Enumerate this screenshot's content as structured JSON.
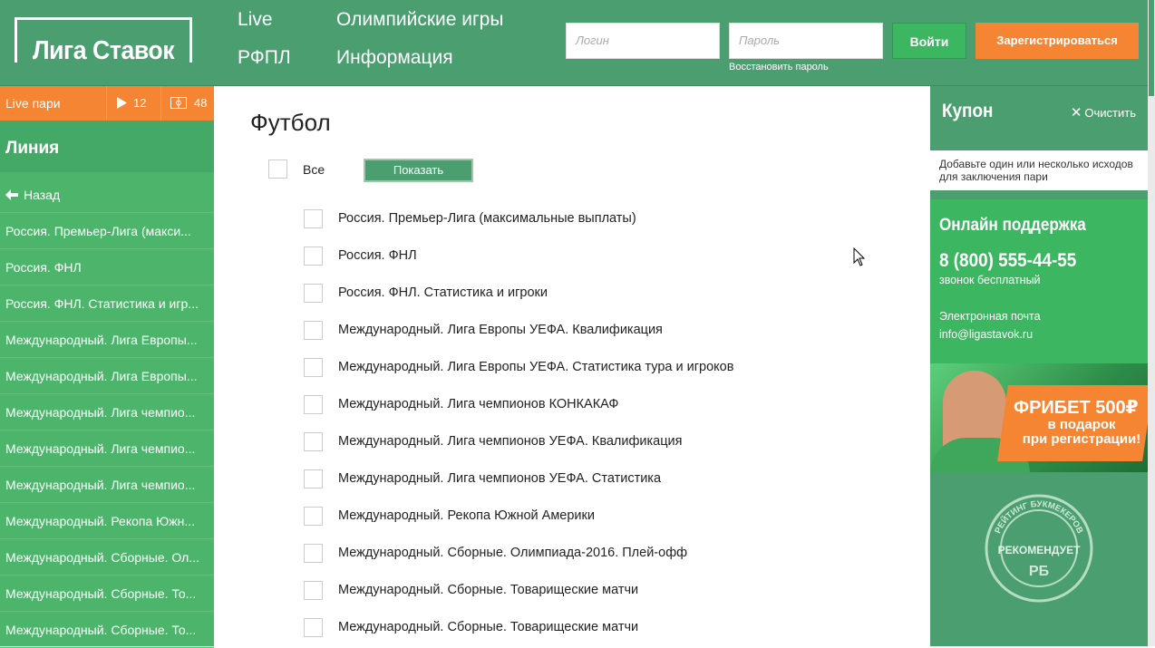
{
  "header": {
    "logo_text": "Лига Ставок",
    "nav": [
      "Live",
      "Олимпийские игры",
      "РФПЛ",
      "Информация"
    ],
    "login_placeholder": "Логин",
    "password_placeholder": "Пароль",
    "restore_password": "Восстановить пароль",
    "login_button": "Войти",
    "register_button": "Зарегистрироваться",
    "accent_color": "#4a9e6f",
    "orange_color": "#f58433"
  },
  "sidebar": {
    "live_label": "Live пари",
    "live_video_count": "12",
    "live_stats_count": "48",
    "section_title": "Линия",
    "back_label": "Назад",
    "items": [
      "Россия. Премьер-Лига (макси...",
      "Россия. ФНЛ",
      "Россия. ФНЛ. Статистика и игр...",
      "Международный. Лига Европы...",
      "Международный. Лига Европы...",
      "Международный. Лига чемпио...",
      "Международный. Лига чемпио...",
      "Международный. Лига чемпио...",
      "Международный. Рекопа Южн...",
      "Международный. Сборные. Ол...",
      "Международный. Сборные. То...",
      "Международный. Сборные. То..."
    ]
  },
  "main": {
    "title": "Футбол",
    "all_label": "Все",
    "show_button": "Показать",
    "leagues": [
      "Россия. Премьер-Лига (максимальные выплаты)",
      "Россия. ФНЛ",
      "Россия. ФНЛ. Статистика и игроки",
      "Международный. Лига Европы УЕФА. Квалификация",
      "Международный. Лига Европы УЕФА. Статистика тура и игроков",
      "Международный. Лига чемпионов КОНКАКАФ",
      "Международный. Лига чемпионов УЕФА. Квалификация",
      "Международный. Лига чемпионов УЕФА. Статистика",
      "Международный. Рекопа Южной Америки",
      "Международный. Сборные. Олимпиада-2016. Плей-офф",
      "Международный. Сборные. Товарищеские матчи",
      "Международный. Сборные. Товарищеские матчи"
    ]
  },
  "coupon": {
    "title": "Купон",
    "clear_label": "Очистить",
    "hint": "Добавьте один или несколько исходов для заключения пари",
    "support_title": "Онлайн поддержка",
    "phone": "8 (800) 555-44-55",
    "phone_note": "звонок бесплатный",
    "email_label": "Электронная почта",
    "email": "info@ligastavok.ru",
    "banner_line1": "ФРИБЕТ 500₽",
    "banner_line2": "в подарок",
    "banner_line3": "при регистрации!",
    "seal_text_top": "РЕЙТИНГ БУКМЕКЕРОВ",
    "seal_text_mid": "РЕКОМЕНДУЕТ",
    "seal_text_logo": "РБ"
  }
}
